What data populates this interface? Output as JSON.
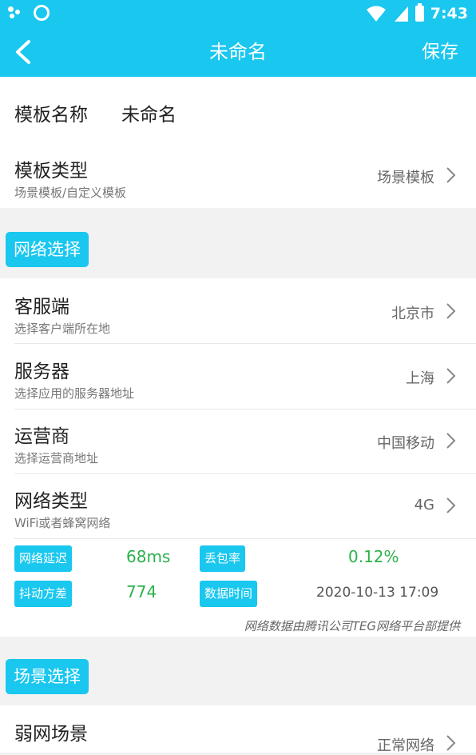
{
  "status_bar": {
    "time": "7:43",
    "icons": [
      "dots-icon",
      "ring-icon",
      "wifi-icon",
      "signal-icon",
      "battery-icon"
    ]
  },
  "app_bar": {
    "title": "未命名",
    "save_label": "保存",
    "back_icon": "chevron-left-icon"
  },
  "template": {
    "name_label": "模板名称",
    "name_value": "未命名",
    "type_label": "模板类型",
    "type_sub": "场景模板/自定义模板",
    "type_value": "场景模板"
  },
  "network": {
    "section_label": "网络选择",
    "items": [
      {
        "label": "客服端",
        "sub": "选择客户端所在地",
        "value": "北京市"
      },
      {
        "label": "服务器",
        "sub": "选择应用的服务器地址",
        "value": "上海"
      },
      {
        "label": "运营商",
        "sub": "选择运营商地址",
        "value": "中国移动"
      },
      {
        "label": "网络类型",
        "sub": "WiFi或者蜂窝网络",
        "value": "4G"
      }
    ],
    "metrics": {
      "latency_label": "网络延迟",
      "latency_value": "68ms",
      "loss_label": "丢包率",
      "loss_value": "0.12%",
      "jitter_label": "抖动方差",
      "jitter_value": "774",
      "time_label": "数据时间",
      "time_value": "2020-10-13 17:09"
    },
    "footnote": "网络数据由腾讯公司TEG网络平台部提供"
  },
  "scene": {
    "section_label": "场景选择",
    "weak_label": "弱网场景",
    "weak_value": "正常网络"
  },
  "colors": {
    "accent": "#19c7ef",
    "metric_green": "#2bb24c",
    "background": "#f2f2f2"
  }
}
